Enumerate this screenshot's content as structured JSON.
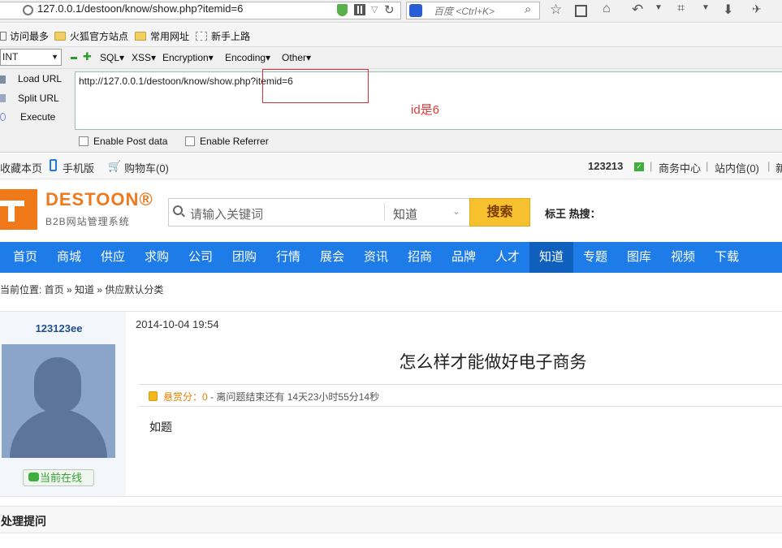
{
  "browser": {
    "url": "127.0.0.1/destoon/know/show.php?itemid=6",
    "search_placeholder": "百度 <Ctrl+K>"
  },
  "bookmarks": [
    "访问最多",
    "火狐官方站点",
    "常用网址",
    "新手上路"
  ],
  "hackbar": {
    "encoding_select": "INT",
    "menus": [
      "SQL▾",
      "XSS▾",
      "Encryption▾",
      "Encoding▾",
      "Other▾"
    ],
    "buttons": [
      "Load URL",
      "Split URL",
      "Execute"
    ],
    "url_value": "http://127.0.0.1/destoon/know/show.php?itemid=6",
    "enable_post": "Enable Post data",
    "enable_referrer": "Enable Referrer"
  },
  "annotation": {
    "label": "id是6",
    "color": "#e23a3a"
  },
  "site_top": {
    "left": [
      "收藏本页",
      "手机版",
      "购物车(0)"
    ],
    "username": "123213",
    "right": [
      "商务中心",
      "站内信(0)",
      "新"
    ]
  },
  "logo": {
    "word": "DESTOON®",
    "sub": "B2B网站管理系统"
  },
  "search": {
    "placeholder": "请输入关键词",
    "module": "知道",
    "button": "搜索",
    "hot_label": "标王 热搜："
  },
  "nav": {
    "items": [
      "首页",
      "商城",
      "供应",
      "求购",
      "公司",
      "团购",
      "行情",
      "展会",
      "资讯",
      "招商",
      "品牌",
      "人才",
      "知道",
      "专题",
      "图库",
      "视频",
      "下载"
    ],
    "active": "知道",
    "color": "#1d7ce8"
  },
  "breadcrumb": "当前位置: 首页 » 知道 » 供应默认分类",
  "user": {
    "name": "123123ee",
    "status": "当前在线"
  },
  "question": {
    "date": "2014-10-04 19:54",
    "title": "怎么样才能做好电子商务",
    "reward_label": "悬赏分：",
    "reward_value": "0",
    "remaining": " - 离问题结束还有 14天23小时55分14秒",
    "body": "如题"
  },
  "bottom": {
    "title": "处理提问"
  }
}
